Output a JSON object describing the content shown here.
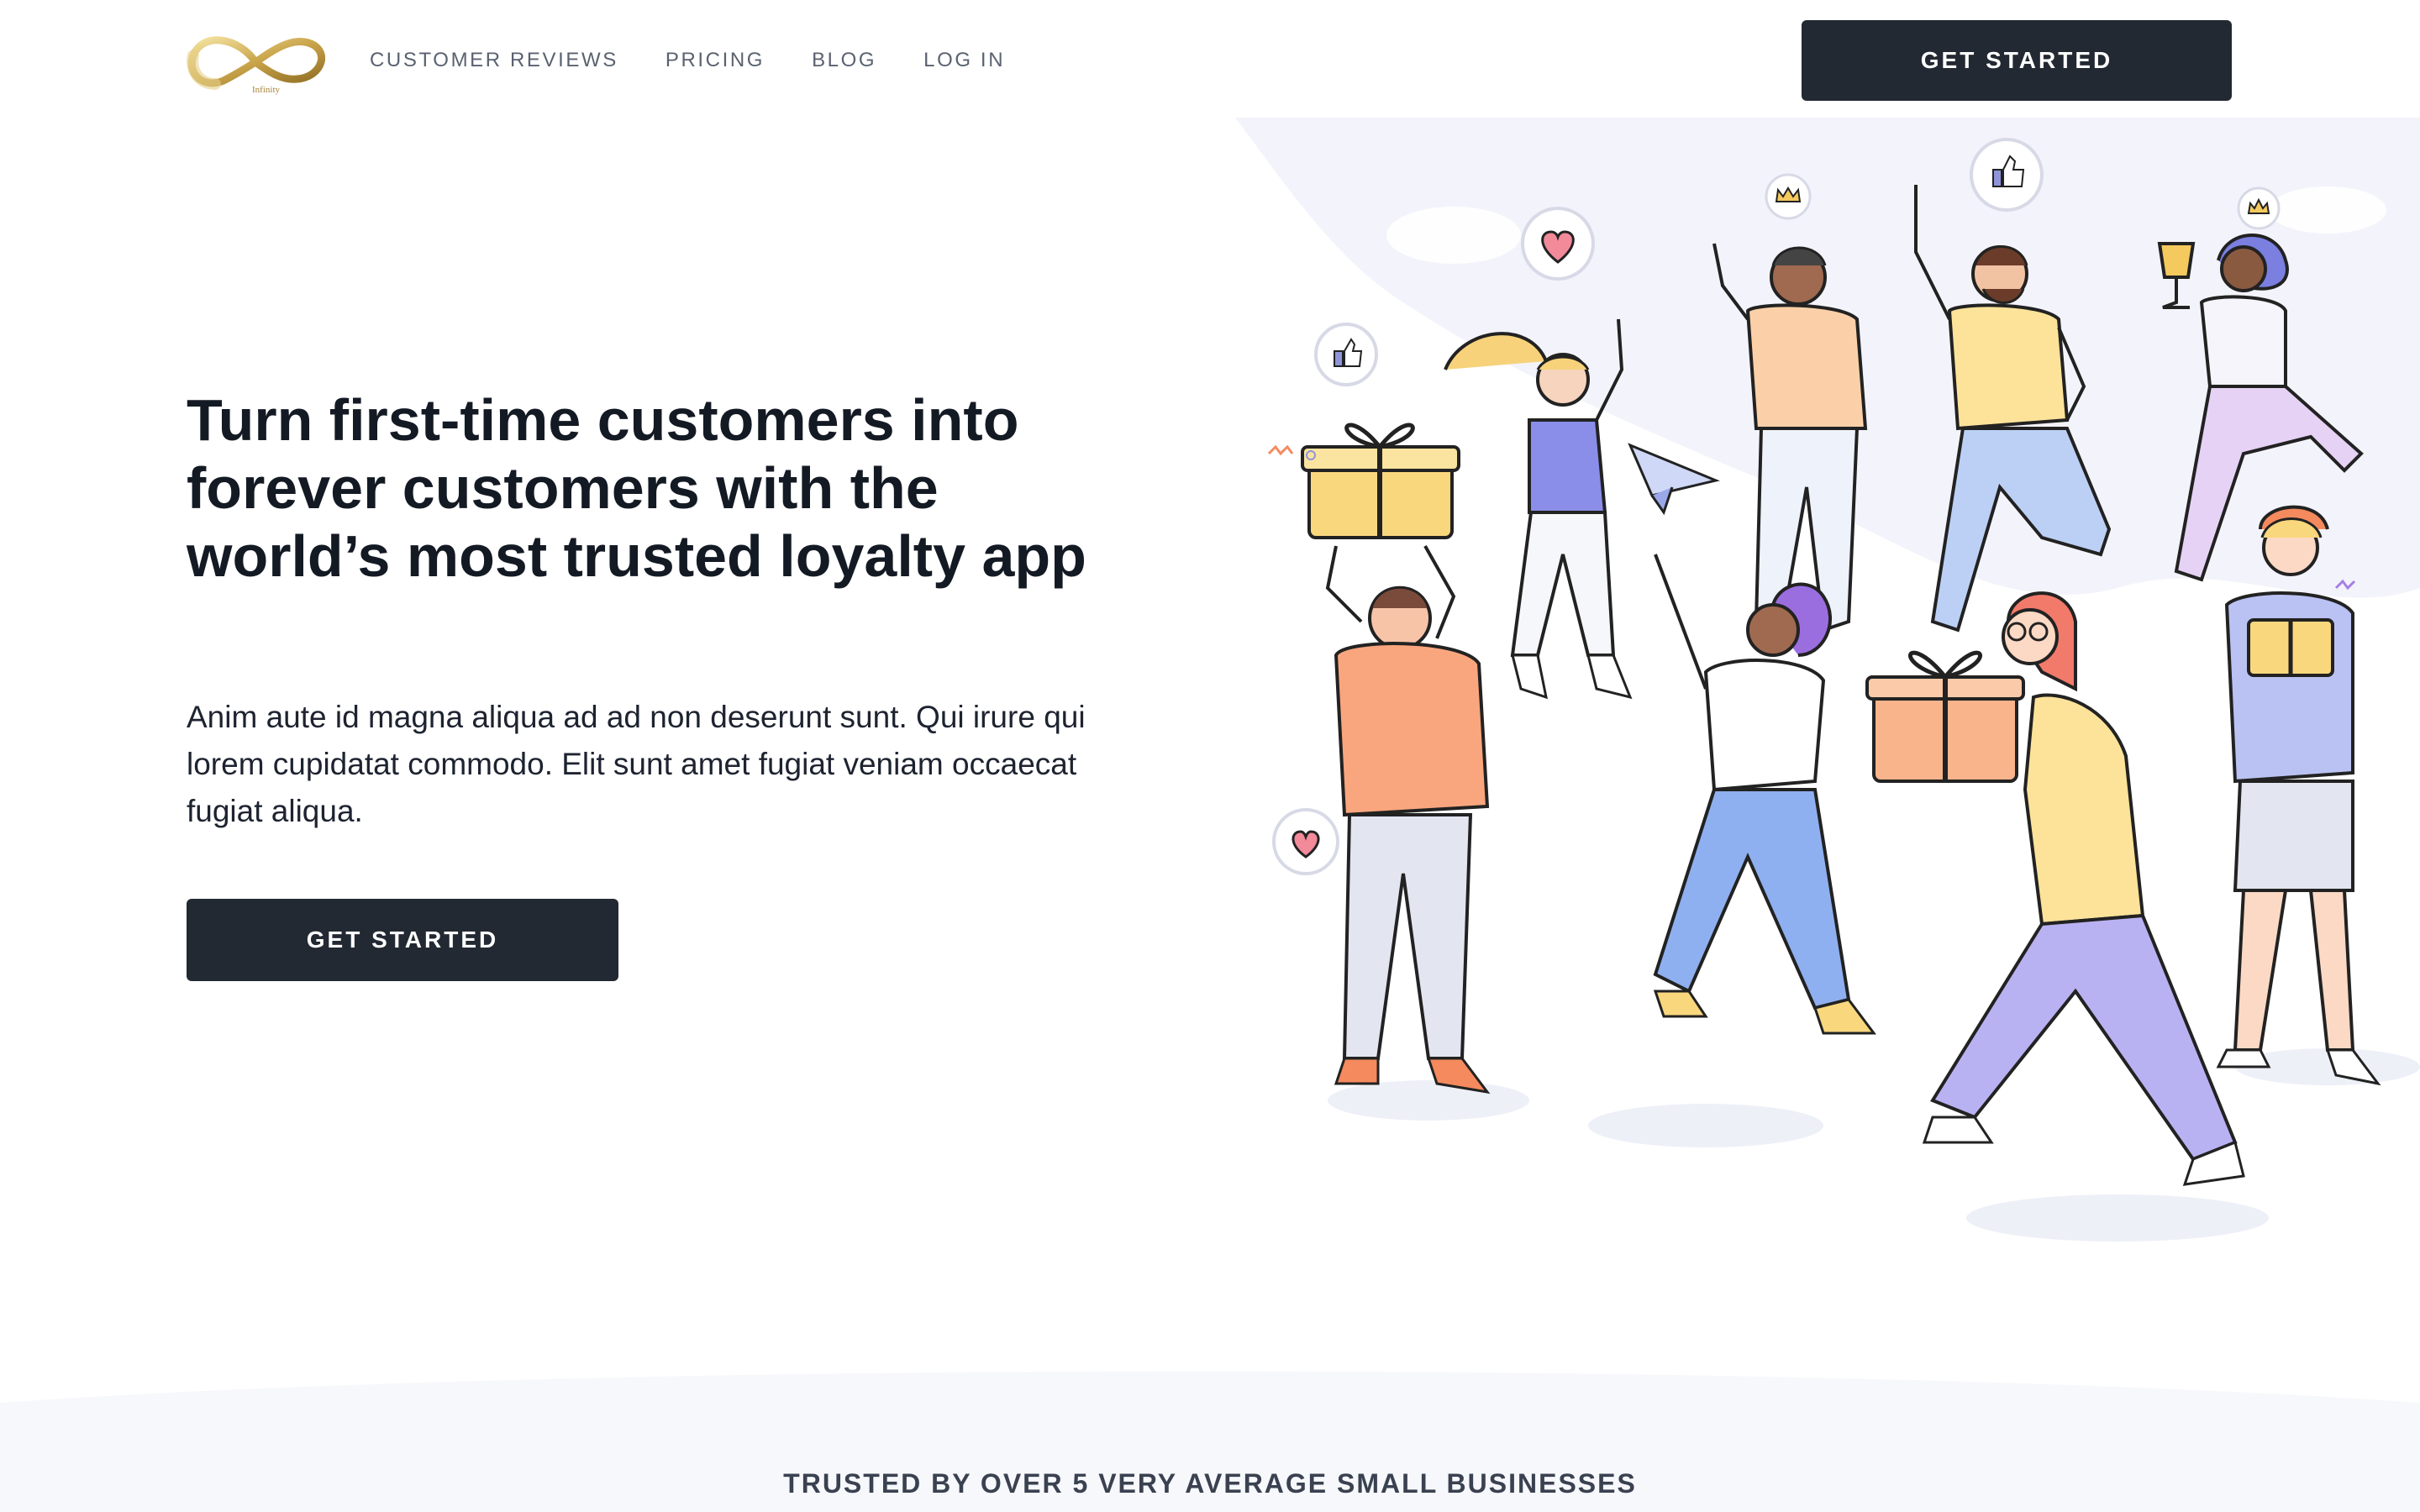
{
  "brand": {
    "logo_text": "Infinity",
    "accent_color": "#c9a44a",
    "button_color": "#232932"
  },
  "nav": {
    "items": [
      {
        "label": "CUSTOMER REVIEWS"
      },
      {
        "label": "PRICING"
      },
      {
        "label": "BLOG"
      },
      {
        "label": "LOG IN"
      }
    ],
    "cta_label": "GET STARTED"
  },
  "hero": {
    "title": "Turn first-time customers into forever customers with the world’s most trusted loyalty app",
    "subtitle": "Anim aute id magna aliqua ad ad non deserunt sunt. Qui irure qui lorem cupidatat commodo. Elit sunt amet fugiat veniam occaecat fugiat aliqua.",
    "cta_label": "GET STARTED",
    "illustration": "people-celebrating-with-gifts"
  },
  "trusted": {
    "text": "TRUSTED BY OVER 5 VERY AVERAGE SMALL BUSINESSES"
  }
}
